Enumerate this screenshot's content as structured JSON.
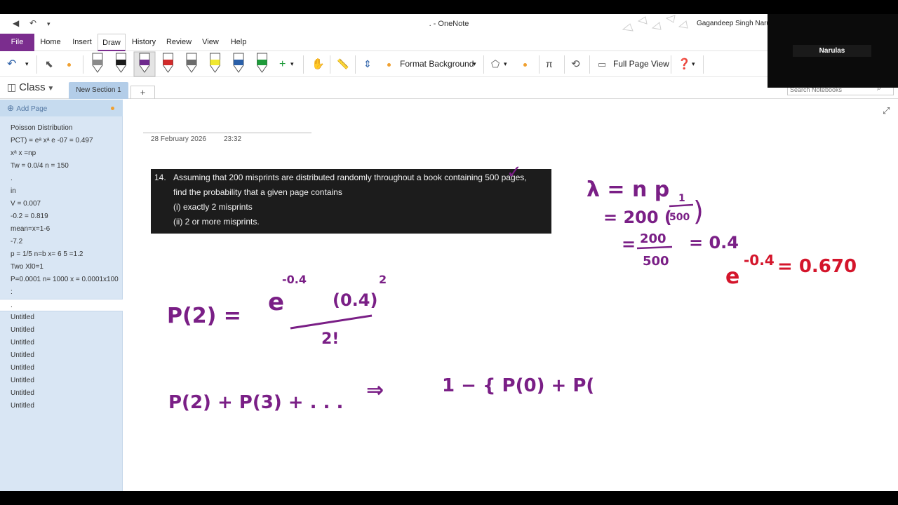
{
  "window": {
    "title": ". - OneNote",
    "user": "Gagandeep Singh Narula"
  },
  "tabs": [
    "File",
    "Home",
    "Insert",
    "Draw",
    "History",
    "Review",
    "View",
    "Help"
  ],
  "toolbar": {
    "format_background": "Format Background",
    "full_page_view": "Full Page View",
    "pen_colors": [
      "#8a8a8a",
      "#1c1c1c",
      "#6f2a8e",
      "#d12b2b",
      "#6c6c6c",
      "#f0e830",
      "#2a5fa8",
      "#1e9b3a"
    ]
  },
  "notebook": {
    "name": "Class",
    "section": "New Section 1",
    "add_section": "+",
    "search_placeholder": "Search Notebooks"
  },
  "sidebar": {
    "add_page": "Add Page",
    "pages": [
      "Poisson Distribution",
      "PCT) = eᵃ xᵃ e -07 = 0.497",
      "xᵃ x =np",
      "Tw = 0.0/4 n = 150",
      ".",
      "in",
      "V = 0.007",
      "-0.2 = 0.819",
      "mean=x=1-6",
      "-7.2",
      "p = 1/5 n=b x= 6 5 =1.2",
      "Two Xl0=1",
      "P=0.0001 n= 1000 x = 0.0001x100",
      ":",
      ".",
      "Untitled",
      "Untitled",
      "Untitled",
      "Untitled",
      "Untitled",
      "Untitled",
      "Untitled",
      "Untitled"
    ],
    "selected_index": 14
  },
  "page": {
    "date": "28 February 2026",
    "time": "23:32",
    "problem": {
      "number": "14.",
      "lines": [
        "Assuming that 200 misprints are distributed randomly throughout a book containing 500 pages,",
        "find the probability that a given page contains",
        "(i) exactly 2 misprints",
        "(ii) 2 or more misprints."
      ]
    },
    "ink": {
      "purple": "#7a1f86",
      "red": "#d4152b",
      "p2": "P(2) =",
      "numerator": "e",
      "exponent": "-0.4",
      "power_base": "(0.4)",
      "power": "2",
      "denominator": "2!",
      "sum": "P(2) + P(3) + . . .",
      "implies": "⇒",
      "complement": "1 − { P(0) + P(",
      "lambda": "λ = n p",
      "calc1": "= 200 (",
      "frac_num": "1",
      "frac_den": "500",
      "calc1_close": ")",
      "calc2_num": "200",
      "calc2_den": "500",
      "calc2_eq": "=",
      "calc2_val": "= 0.4",
      "eq_lead": "=",
      "red_base": "e",
      "red_exp": "-0.4",
      "red_val": "= 0.670",
      "check": "✓"
    }
  },
  "video": {
    "name": "Narulas"
  }
}
